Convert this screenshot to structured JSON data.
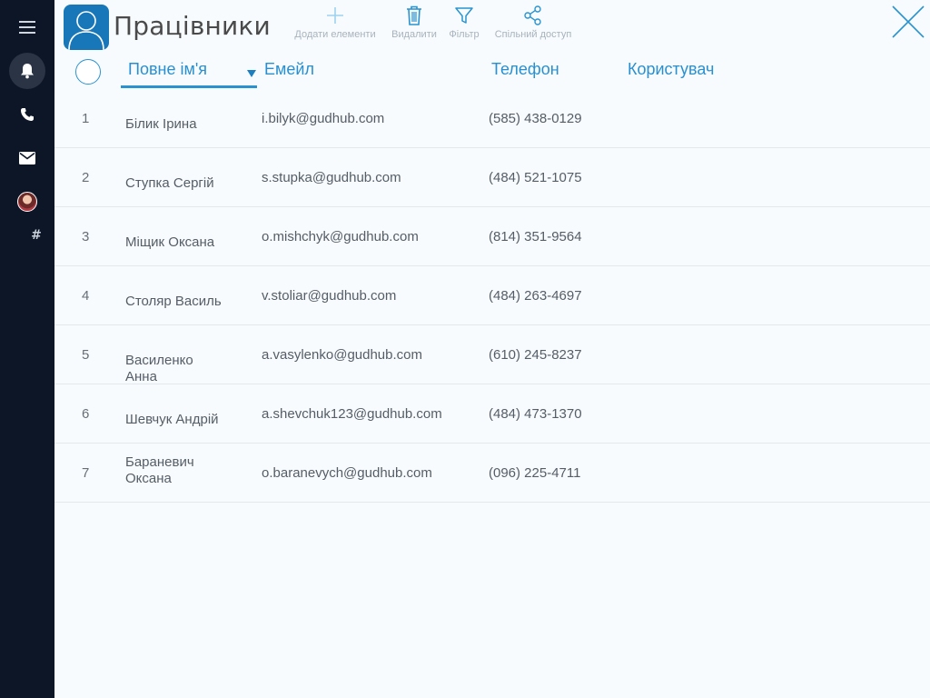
{
  "sidebar": {
    "items": [
      {
        "icon": "hamburger-menu-icon"
      },
      {
        "icon": "bell-icon",
        "active": true
      },
      {
        "icon": "phone-icon"
      },
      {
        "icon": "mail-icon"
      },
      {
        "icon": "user-avatar"
      },
      {
        "icon": "hash-icon",
        "label": "#"
      }
    ]
  },
  "header": {
    "title": "Працівники",
    "toolbar": {
      "add_label": "Додати елементи",
      "delete_label": "Видалити",
      "filter_label": "Фільтр",
      "share_label": "Спільний доступ"
    }
  },
  "table": {
    "columns": [
      "Повне ім'я",
      "Емейл",
      "Телефон",
      "Користувач"
    ],
    "sorted_column": "Повне ім'я",
    "rows": [
      {
        "num": "1",
        "name": "Білик Ірина",
        "email": "i.bilyk@gudhub.com",
        "phone": "(585) 438-0129"
      },
      {
        "num": "2",
        "name": "Ступка Сергій",
        "email": "s.stupka@gudhub.com",
        "phone": "(484) 521-1075"
      },
      {
        "num": "3",
        "name": "Міщик Оксана",
        "email": "o.mishchyk@gudhub.com",
        "phone": "(814) 351-9564"
      },
      {
        "num": "4",
        "name": "Столяр Василь",
        "email": "v.stoliar@gudhub.com",
        "phone": "(484) 263-4697"
      },
      {
        "num": "5",
        "name": "Василенко Анна",
        "email": "a.vasylenko@gudhub.com",
        "phone": "(610) 245-8237"
      },
      {
        "num": "6",
        "name": "Шевчук Андрій",
        "email": "a.shevchuk123@gudhub.com",
        "phone": "(484) 473-1370"
      },
      {
        "num": "7",
        "name": "Бараневич Оксана",
        "email": "o.baranevych@gudhub.com",
        "phone": "(096) 225-4711"
      }
    ]
  },
  "colors": {
    "sidebar_bg": "#0c1626",
    "accent": "#2a93cf",
    "app_icon_bg": "#1877b8",
    "page_bg": "#f7fbfd"
  }
}
